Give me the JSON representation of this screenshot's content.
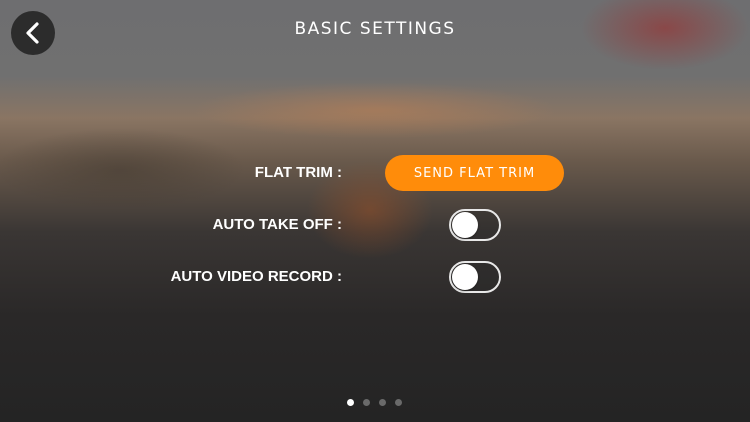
{
  "header": {
    "title": "BASIC SETTINGS",
    "back_icon": "chevron-left-icon"
  },
  "settings": {
    "flat_trim": {
      "label": "FLAT TRIM :",
      "button_label": "SEND FLAT TRIM"
    },
    "auto_take_off": {
      "label": "AUTO TAKE OFF :",
      "enabled": false
    },
    "auto_video_record": {
      "label": "AUTO VIDEO RECORD :",
      "enabled": false
    }
  },
  "pager": {
    "total_pages": 4,
    "current_page": 1
  },
  "colors": {
    "accent": "#ff8c0a",
    "toggle_border": "#e8e8e8",
    "dot_inactive": "#6a6a6a",
    "dot_active": "#ffffff"
  }
}
